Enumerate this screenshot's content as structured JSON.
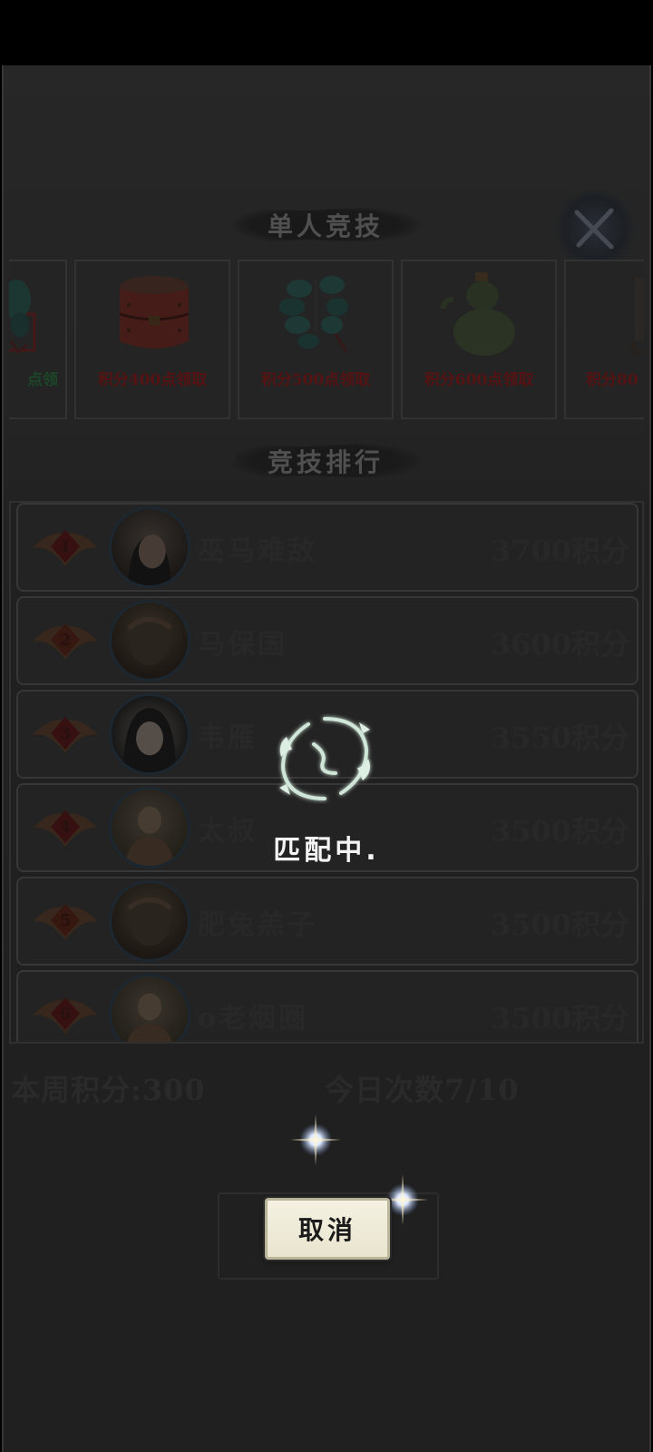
{
  "header": {
    "title": "单人竞技",
    "close_icon": "close-icon"
  },
  "rewards": [
    {
      "label": "点领",
      "icon": "jade-pendant-icon",
      "color": "#1d4a2a"
    },
    {
      "label": "积分400点领取",
      "icon": "treasure-box-icon",
      "color": "#5a1515"
    },
    {
      "label": "积分500点领取",
      "icon": "jade-necklace-icon",
      "color": "#5a1515"
    },
    {
      "label": "积分600点领取",
      "icon": "gourd-icon",
      "color": "#5a1515"
    },
    {
      "label": "积分80",
      "icon": "chest-icon",
      "color": "#5a1515"
    }
  ],
  "ranking": {
    "title": "竞技排行",
    "rows": [
      {
        "rank": "1",
        "name": "巫马难敌",
        "score": "3700积分",
        "avatar": "female-portrait"
      },
      {
        "rank": "2",
        "name": "马保国",
        "score": "3600积分",
        "avatar": "warrior-portrait"
      },
      {
        "rank": "3",
        "name": "韦雁",
        "score": "3550积分",
        "avatar": "lady-portrait"
      },
      {
        "rank": "4",
        "name": "太叔",
        "score": "3500积分",
        "avatar": "monk-portrait"
      },
      {
        "rank": "5",
        "name": "肥兔羔子",
        "score": "3500积分",
        "avatar": "warrior-portrait"
      },
      {
        "rank": "6",
        "name": "o老烟圈",
        "score": "3500积分",
        "avatar": "monk-portrait"
      }
    ]
  },
  "footer": {
    "week_points": "本周积分:300",
    "today_count": "今日次数7/10"
  },
  "matching": {
    "status_text": "匹配中.",
    "icon": "yin-yang-dragon-icon",
    "cancel_label": "取消"
  }
}
